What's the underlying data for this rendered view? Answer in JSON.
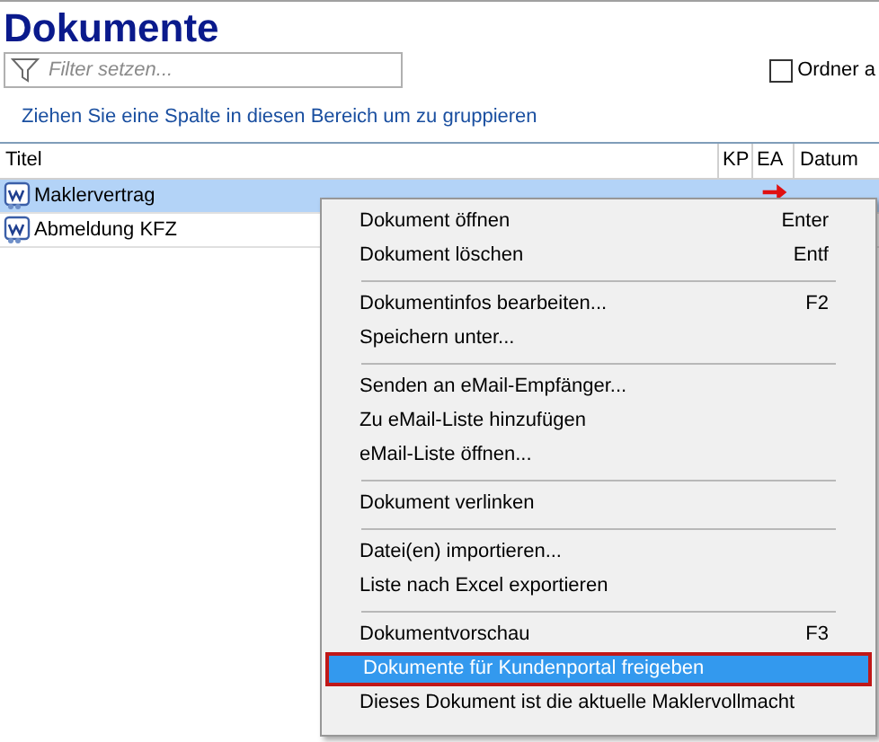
{
  "title": "Dokumente",
  "filter": {
    "placeholder": "Filter setzen..."
  },
  "folder_checkbox": {
    "label": "Ordner a",
    "checked": false
  },
  "group_hint": "Ziehen Sie eine Spalte in diesen Bereich um zu gruppieren",
  "table": {
    "columns": [
      "Titel",
      "KP",
      "EA",
      "Datum"
    ],
    "rows": [
      {
        "title": "Maklervertrag",
        "selected": true,
        "ea_arrow": true
      },
      {
        "title": "Abmeldung KFZ",
        "selected": false
      }
    ]
  },
  "context_menu": [
    {
      "kind": "item",
      "label": "Dokument öffnen",
      "shortcut": "Enter",
      "selected": false
    },
    {
      "kind": "item",
      "label": "Dokument löschen",
      "shortcut": "Entf",
      "selected": false
    },
    {
      "kind": "separator"
    },
    {
      "kind": "item",
      "label": "Dokumentinfos bearbeiten...",
      "shortcut": "F2",
      "selected": false
    },
    {
      "kind": "item",
      "label": "Speichern unter...",
      "selected": false
    },
    {
      "kind": "separator"
    },
    {
      "kind": "item",
      "label": "Senden an eMail-Empfänger...",
      "selected": false
    },
    {
      "kind": "item",
      "label": "Zu eMail-Liste hinzufügen",
      "selected": false
    },
    {
      "kind": "item",
      "label": "eMail-Liste öffnen...",
      "selected": false
    },
    {
      "kind": "separator"
    },
    {
      "kind": "item",
      "label": "Dokument verlinken",
      "selected": false
    },
    {
      "kind": "separator"
    },
    {
      "kind": "item",
      "label": "Datei(en) importieren...",
      "selected": false
    },
    {
      "kind": "item",
      "label": "Liste nach Excel exportieren",
      "selected": false
    },
    {
      "kind": "separator"
    },
    {
      "kind": "item",
      "label": "Dokumentvorschau",
      "shortcut": "F3",
      "selected": false
    },
    {
      "kind": "item",
      "label": "Dokumente für Kundenportal freigeben",
      "selected": true
    },
    {
      "kind": "item",
      "label": "Dieses Dokument ist die aktuelle Maklervollmacht",
      "selected": false
    }
  ]
}
